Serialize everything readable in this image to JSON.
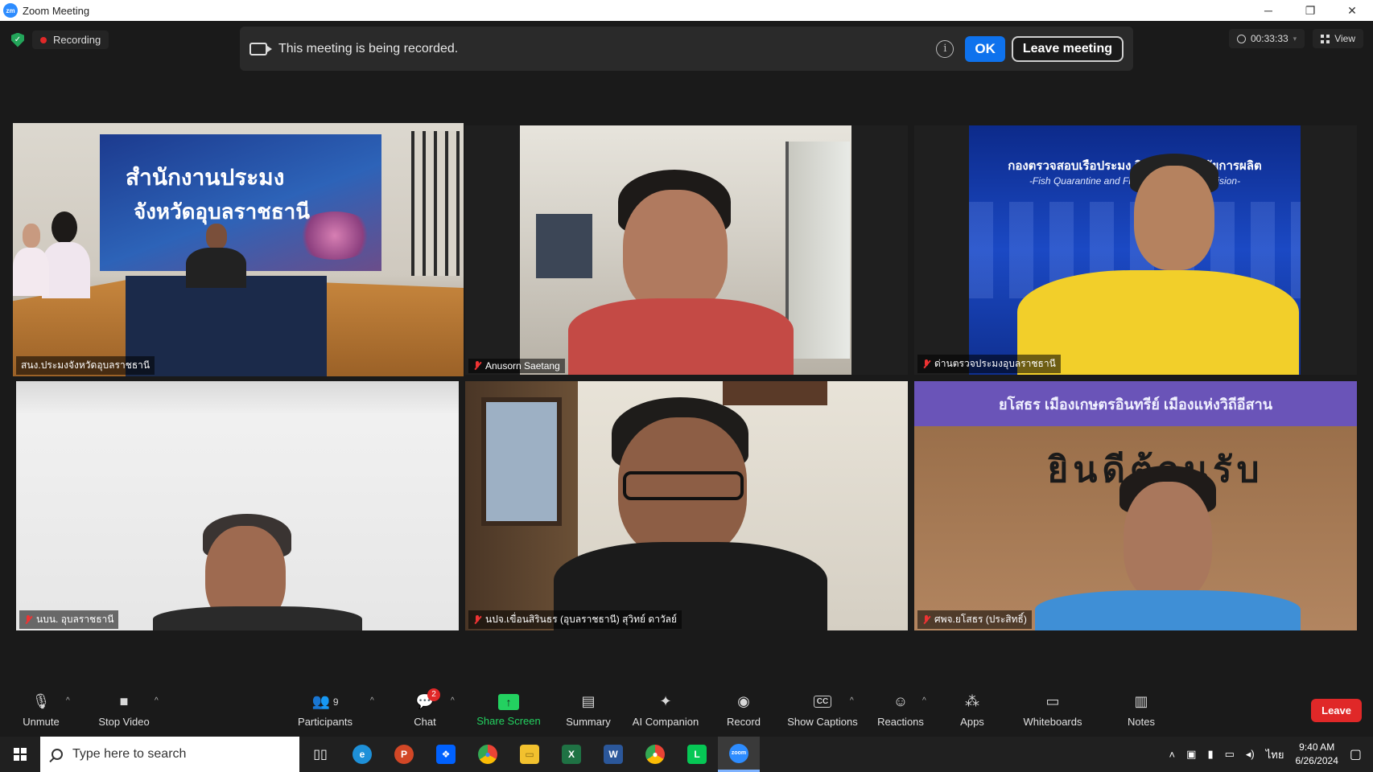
{
  "window": {
    "title": "Zoom Meeting",
    "minimize": "─",
    "restore": "❐",
    "close": "✕"
  },
  "status": {
    "recording_label": "Recording"
  },
  "banner": {
    "message": "This meeting is being recorded.",
    "info_glyph": "i",
    "ok_label": "OK",
    "leave_label": "Leave meeting"
  },
  "timer": {
    "elapsed": "00:33:33",
    "caret": "▾"
  },
  "view": {
    "label": "View"
  },
  "participants_tiles": [
    {
      "name": "สนง.ประมงจังหวัดอุบลราชธานี",
      "muted": false,
      "active": true,
      "banner_line1": "สำนักงานประมง",
      "banner_line2": "จังหวัดอุบลราชธานี"
    },
    {
      "name": "Anusorn Saetang",
      "muted": true
    },
    {
      "name": "ด่านตรวจประมงอุบลราชธานี",
      "muted": true,
      "backdrop_line1": "กองตรวจสอบเรือประมง สินค้า และปัจจัยการผลิต",
      "backdrop_line2": "-Fish Quarantine and Fishing Inspection Division-"
    },
    {
      "name": "นบน. อุบลราชธานี",
      "muted": true
    },
    {
      "name": "นปจ.เขื่อนสิรินธร (อุบลราชธานี) สุวิทย์ ดาวัลย์",
      "muted": true
    },
    {
      "name": "ศพจ.ยโสธร (ประสิทธิ์)",
      "muted": true,
      "sign_line1": "ยโสธร   เมืองเกษตรอินทรีย์   เมืองแห่งวิถีอีสาน",
      "sign_line2": "ยินดีต้อนรับ"
    }
  ],
  "toolbar": {
    "unmute": "Unmute",
    "stop_video": "Stop Video",
    "participants": "Participants",
    "participants_count": "9",
    "chat": "Chat",
    "chat_badge": "2",
    "share_screen": "Share Screen",
    "summary": "Summary",
    "ai_companion": "AI Companion",
    "record": "Record",
    "show_captions": "Show Captions",
    "cc_glyph": "CC",
    "reactions": "Reactions",
    "apps": "Apps",
    "whiteboards": "Whiteboards",
    "notes": "Notes",
    "leave": "Leave",
    "caret": "^"
  },
  "taskbar": {
    "search_placeholder": "Type here to search",
    "apps": [
      {
        "name": "edge",
        "glyph": "e",
        "color": "#1e90d8"
      },
      {
        "name": "powerpoint",
        "glyph": "P",
        "color": "#d24726"
      },
      {
        "name": "dropbox",
        "glyph": "❖",
        "color": "#0061fe"
      },
      {
        "name": "chrome",
        "glyph": "●",
        "color": "#34a853"
      },
      {
        "name": "file-explorer",
        "glyph": "▭",
        "color": "#f2c12e"
      },
      {
        "name": "excel",
        "glyph": "X",
        "color": "#1f7244"
      },
      {
        "name": "word",
        "glyph": "W",
        "color": "#2b579a"
      },
      {
        "name": "chrome-profile",
        "glyph": "●",
        "color": "#ea4335"
      },
      {
        "name": "line",
        "glyph": "L",
        "color": "#06c755"
      },
      {
        "name": "zoom",
        "glyph": "zoom",
        "color": "#2d8cff"
      }
    ],
    "language": "ไทย",
    "time": "9:40 AM",
    "date": "6/26/2024"
  }
}
